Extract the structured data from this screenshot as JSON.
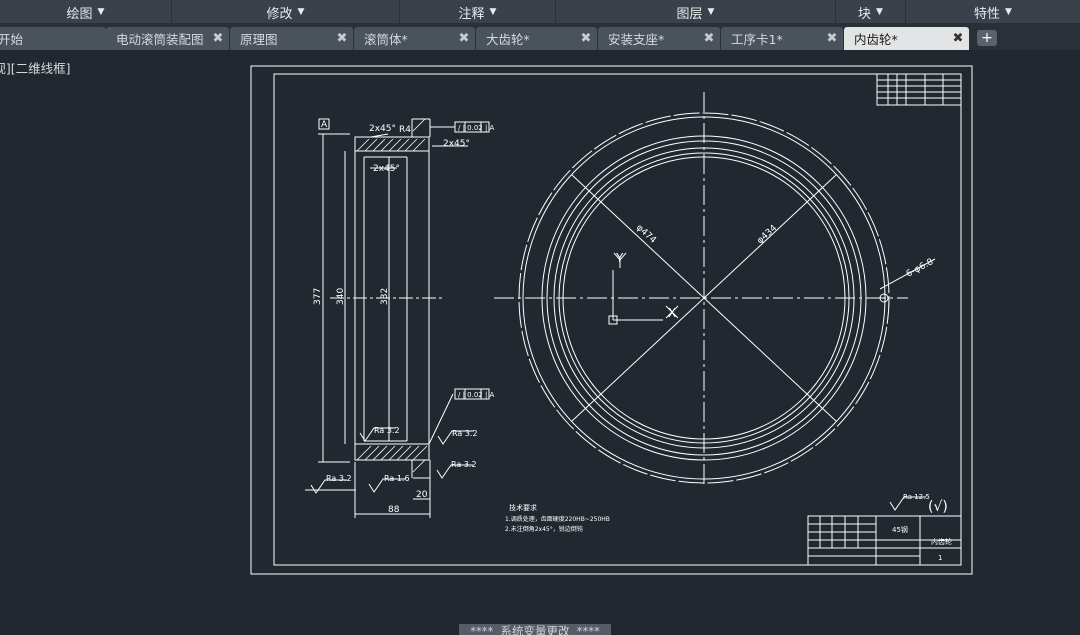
{
  "ribbon": {
    "panels": [
      {
        "label": "绘图",
        "caret": "▼"
      },
      {
        "label": "修改",
        "caret": "▼"
      },
      {
        "label": "注释",
        "caret": "▼"
      },
      {
        "label": "图层",
        "caret": "▼"
      },
      {
        "label": "块",
        "caret": "▼"
      },
      {
        "label": "特性",
        "caret": "▼"
      }
    ]
  },
  "tabs": [
    {
      "label": "开始",
      "close": ""
    },
    {
      "label": "电动滚筒装配图",
      "close": "✖"
    },
    {
      "label": "原理图",
      "close": "✖"
    },
    {
      "label": "滚筒体*",
      "close": "✖"
    },
    {
      "label": "大齿轮*",
      "close": "✖"
    },
    {
      "label": "安装支座*",
      "close": "✖"
    },
    {
      "label": "工序卡1*",
      "close": "✖"
    },
    {
      "label": "内齿轮*",
      "close": "✖",
      "active": true
    }
  ],
  "new_tab": "+",
  "viewport_label": "[俯视][二维线框]",
  "drawing": {
    "datum": "A",
    "chamfer_top": "2x45°",
    "radius": "R4",
    "chamfer_right": "2x45°",
    "chamfer_inner": "2x45°",
    "tol_top": "/ | 0.02 | A",
    "tol_bottom": "/ | 0.02 | A",
    "dim_377": "377",
    "dim_340": "340",
    "dim_332": "332",
    "ra_1": "Ra 3.2",
    "ra_2": "Ra 3.2",
    "ra_3": "Ra 3.2",
    "ra_4": "Ra 3.2",
    "ra_5": "Ra 1.6",
    "dim_20": "20",
    "dim_88": "88",
    "phi_474": "φ474",
    "phi_434": "φ434",
    "holes": "6-φ6.8",
    "axis_y": "Y",
    "axis_x": "X",
    "tech_title": "技术要求",
    "tech_1": "1.调质处理，齿面硬度220HB~250HB",
    "tech_2": "2.未注倒角2x45°，锐边倒钝",
    "ra_general": "Ra 12.5",
    "ra_check": "(√)",
    "tb_material": "45钢",
    "tb_name": "内齿轮",
    "tb_scale": "1"
  },
  "status": {
    "message": "****  系统变量更改  ****"
  },
  "colors": {
    "background": "#212830",
    "ribbon": "#3a414a",
    "tab": "#4a525c",
    "tab_active": "#e2e4e6",
    "lines": "#ffffff"
  }
}
